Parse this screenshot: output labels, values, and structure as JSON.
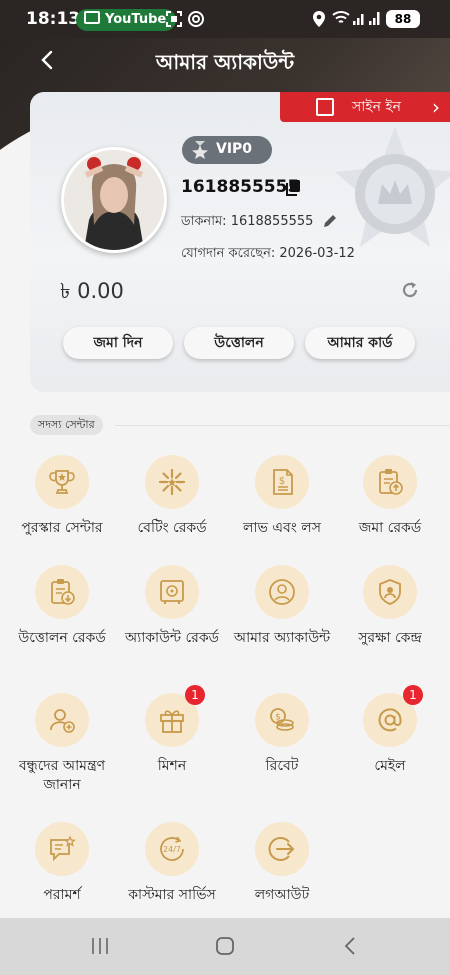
{
  "status_bar": {
    "time": "18:13",
    "notification_app": "YouTube",
    "battery": "88"
  },
  "header": {
    "title": "আমার অ্যাকাউন্ট"
  },
  "sign_in": {
    "label": "সাইন ইন"
  },
  "profile": {
    "vip_label": "VIP0",
    "user_id": "1618855555",
    "nickname": "ডাকনাম: 1618855555",
    "joined": "যোগদান করেছেন: 2026-03-12",
    "balance": "৳ 0.00"
  },
  "actions": {
    "deposit": "জমা দিন",
    "withdraw": "উত্তোলন",
    "my_card": "আমার কার্ড"
  },
  "section": {
    "title": "সদস্য সেন্টার"
  },
  "menu": [
    {
      "label": "পুরস্কার সেন্টার",
      "icon": "trophy-icon"
    },
    {
      "label": "বেটিং রেকর্ড",
      "icon": "star-burst-icon"
    },
    {
      "label": "লাভ এবং লস",
      "icon": "document-dollar-icon"
    },
    {
      "label": "জমা রেকর্ড",
      "icon": "clipboard-upload-icon"
    },
    {
      "label": "উত্তোলন রেকর্ড",
      "icon": "clipboard-download-icon"
    },
    {
      "label": "অ্যাকাউন্ট রেকর্ড",
      "icon": "safe-icon"
    },
    {
      "label": "আমার অ্যাকাউন্ট",
      "icon": "user-icon"
    },
    {
      "label": "সুরক্ষা কেন্দ্র",
      "icon": "shield-user-icon"
    },
    {
      "label": "বন্ধুদের আমন্ত্রণ জানান",
      "icon": "add-user-icon"
    },
    {
      "label": "মিশন",
      "icon": "gift-icon",
      "badge": "1"
    },
    {
      "label": "রিবেট",
      "icon": "coins-icon"
    },
    {
      "label": "মেইল",
      "icon": "at-sign-icon",
      "badge": "1"
    },
    {
      "label": "পরামর্শ",
      "icon": "feedback-icon"
    },
    {
      "label": "কাস্টমার সার্ভিস",
      "icon": "support-24-7-icon"
    },
    {
      "label": "লগআউট",
      "icon": "logout-icon"
    }
  ],
  "colors": {
    "accent": "#d7262c",
    "icon_bg": "#f7e8cd",
    "icon_stroke": "#c89a4c"
  }
}
